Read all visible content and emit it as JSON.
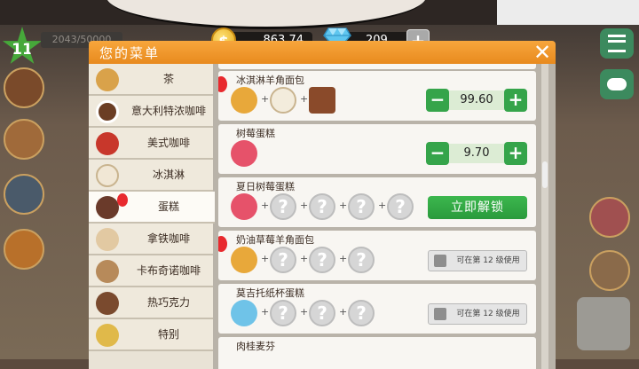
{
  "hud": {
    "level": "11",
    "xp": "2043/50000",
    "coins": "863.74",
    "gems": "209",
    "gem_plus": "+",
    "coin_symbol": "$"
  },
  "panel": {
    "title": "您的菜单",
    "close": "✕"
  },
  "categories": [
    {
      "label": "茶"
    },
    {
      "label": "意大利特浓咖啡"
    },
    {
      "label": "美式咖啡"
    },
    {
      "label": "冰淇淋"
    },
    {
      "label": "蛋糕"
    },
    {
      "label": "拿铁咖啡"
    },
    {
      "label": "卡布奇诺咖啡"
    },
    {
      "label": "热巧克力"
    },
    {
      "label": "特别"
    }
  ],
  "recipes": [
    {
      "title": "冰淇淋羊角面包",
      "price": "99.60"
    },
    {
      "title": "树莓蛋糕",
      "price": "9.70"
    },
    {
      "title": "夏日树莓蛋糕",
      "action": "立即解锁"
    },
    {
      "title": "奶油草莓羊角面包",
      "lock": "可在第 12 级使用"
    },
    {
      "title": "莫吉托纸杯蛋糕",
      "lock": "可在第 12 级使用"
    },
    {
      "title": "肉桂麦芬"
    }
  ],
  "symbols": {
    "minus": "−",
    "plus": "+",
    "question": "?",
    "sep": "+"
  },
  "colors": {
    "header": "#f29a2e",
    "green": "#35a44a",
    "balloon": "#e8292e"
  }
}
